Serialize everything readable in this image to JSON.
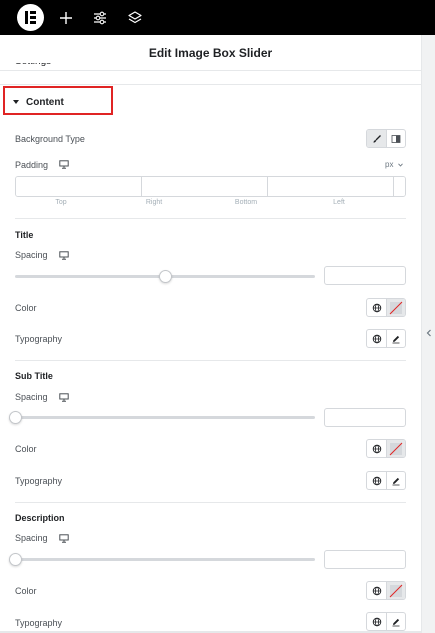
{
  "topbar": {
    "logo": "elementor-logo",
    "icons": [
      "plus-icon",
      "sliders-icon",
      "layers-icon"
    ]
  },
  "header": {
    "title": "Edit Image Box Slider"
  },
  "section": {
    "label": "Content",
    "highlight_color": "#e02424"
  },
  "content": {
    "background_type": {
      "label": "Background Type",
      "options": [
        "brush-icon",
        "gradient-icon"
      ]
    },
    "padding": {
      "label": "Padding",
      "unit": "px",
      "fields": [
        {
          "label": "Top",
          "value": ""
        },
        {
          "label": "Right",
          "value": ""
        },
        {
          "label": "Bottom",
          "value": ""
        },
        {
          "label": "Left",
          "value": ""
        }
      ]
    },
    "groups": [
      {
        "title": "Title",
        "spacing_label": "Spacing",
        "spacing_value": "",
        "slider_fraction": 0.5,
        "color_label": "Color",
        "typography_label": "Typography"
      },
      {
        "title": "Sub Title",
        "spacing_label": "Spacing",
        "spacing_value": "",
        "slider_fraction": 0.0,
        "color_label": "Color",
        "typography_label": "Typography"
      },
      {
        "title": "Description",
        "spacing_label": "Spacing",
        "spacing_value": "",
        "slider_fraction": 0.0,
        "color_label": "Color",
        "typography_label": "Typography"
      }
    ]
  },
  "colors": {
    "topbar": "#000000",
    "accent_red": "#e02424",
    "border": "#d5d8dc",
    "label": "#4b5056"
  }
}
